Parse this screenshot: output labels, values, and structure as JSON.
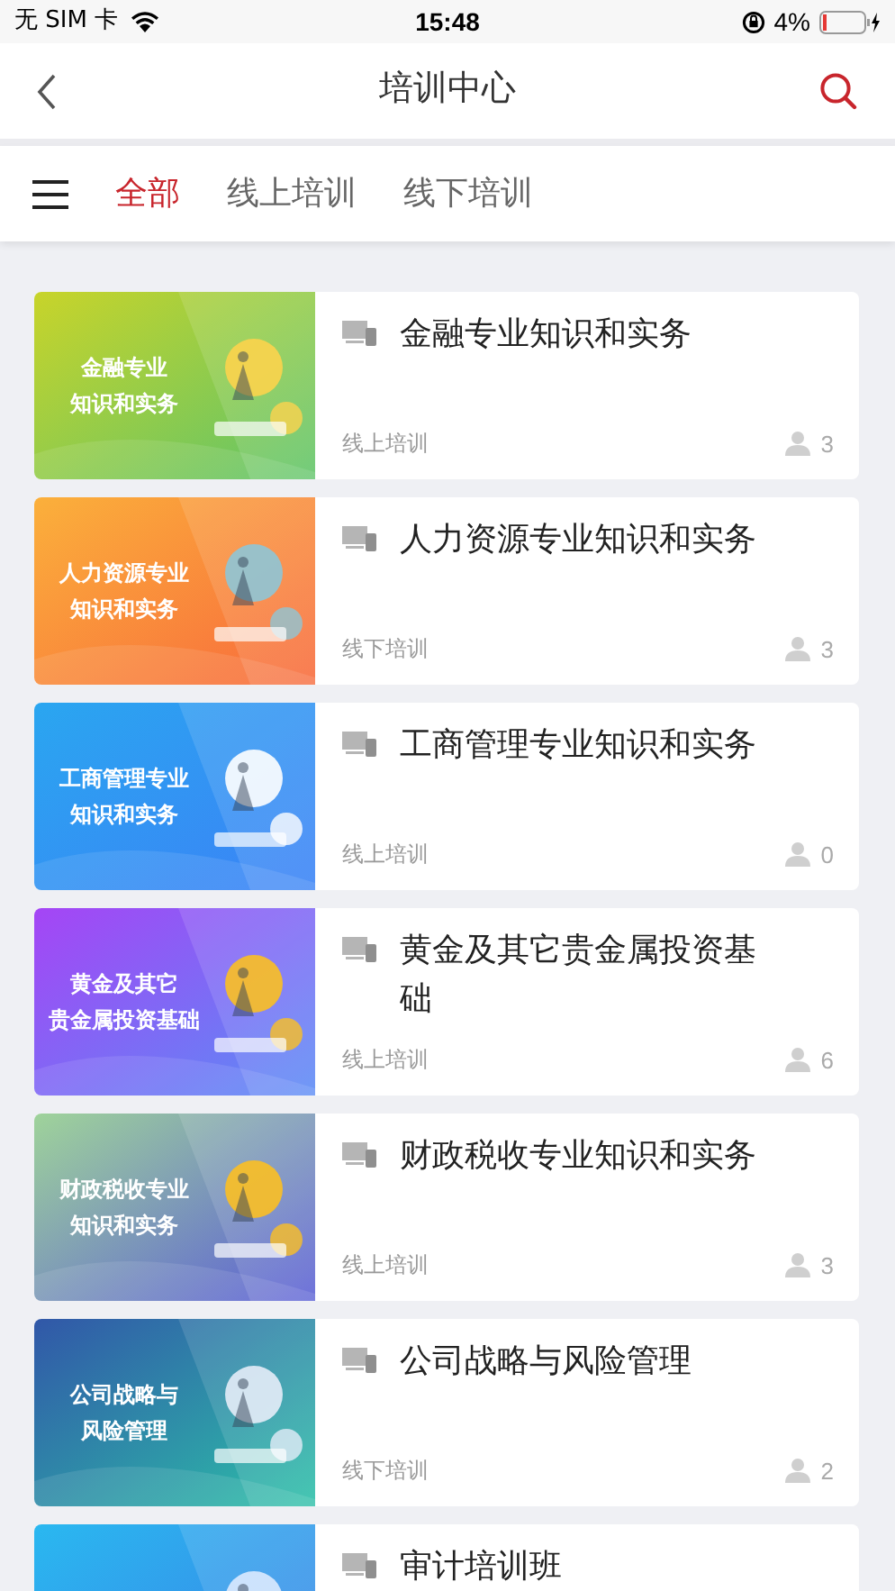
{
  "status_bar": {
    "carrier": "无 SIM 卡",
    "time": "15:48",
    "battery": "4%"
  },
  "nav": {
    "title": "培训中心"
  },
  "tabs": [
    {
      "label": "全部",
      "selected": true
    },
    {
      "label": "线上培训",
      "selected": false
    },
    {
      "label": "线下培训",
      "selected": false
    }
  ],
  "courses": [
    {
      "thumb_lines": [
        "金融专业",
        "知识和实务"
      ],
      "title": "金融专业知识和实务",
      "mode": "线上培训",
      "count": "3"
    },
    {
      "thumb_lines": [
        "人力资源专业",
        "知识和实务"
      ],
      "title": "人力资源专业知识和实务",
      "mode": "线下培训",
      "count": "3"
    },
    {
      "thumb_lines": [
        "工商管理专业",
        "知识和实务"
      ],
      "title": "工商管理专业知识和实务",
      "mode": "线上培训",
      "count": "0"
    },
    {
      "thumb_lines": [
        "黄金及其它",
        "贵金属投资基础"
      ],
      "title": "黄金及其它贵金属投资基础",
      "mode": "线上培训",
      "count": "6"
    },
    {
      "thumb_lines": [
        "财政税收专业",
        "知识和实务"
      ],
      "title": "财政税收专业知识和实务",
      "mode": "线上培训",
      "count": "3"
    },
    {
      "thumb_lines": [
        "公司战略与",
        "风险管理"
      ],
      "title": "公司战略与风险管理",
      "mode": "线下培训",
      "count": "2"
    },
    {
      "title": "审计培训班"
    }
  ]
}
